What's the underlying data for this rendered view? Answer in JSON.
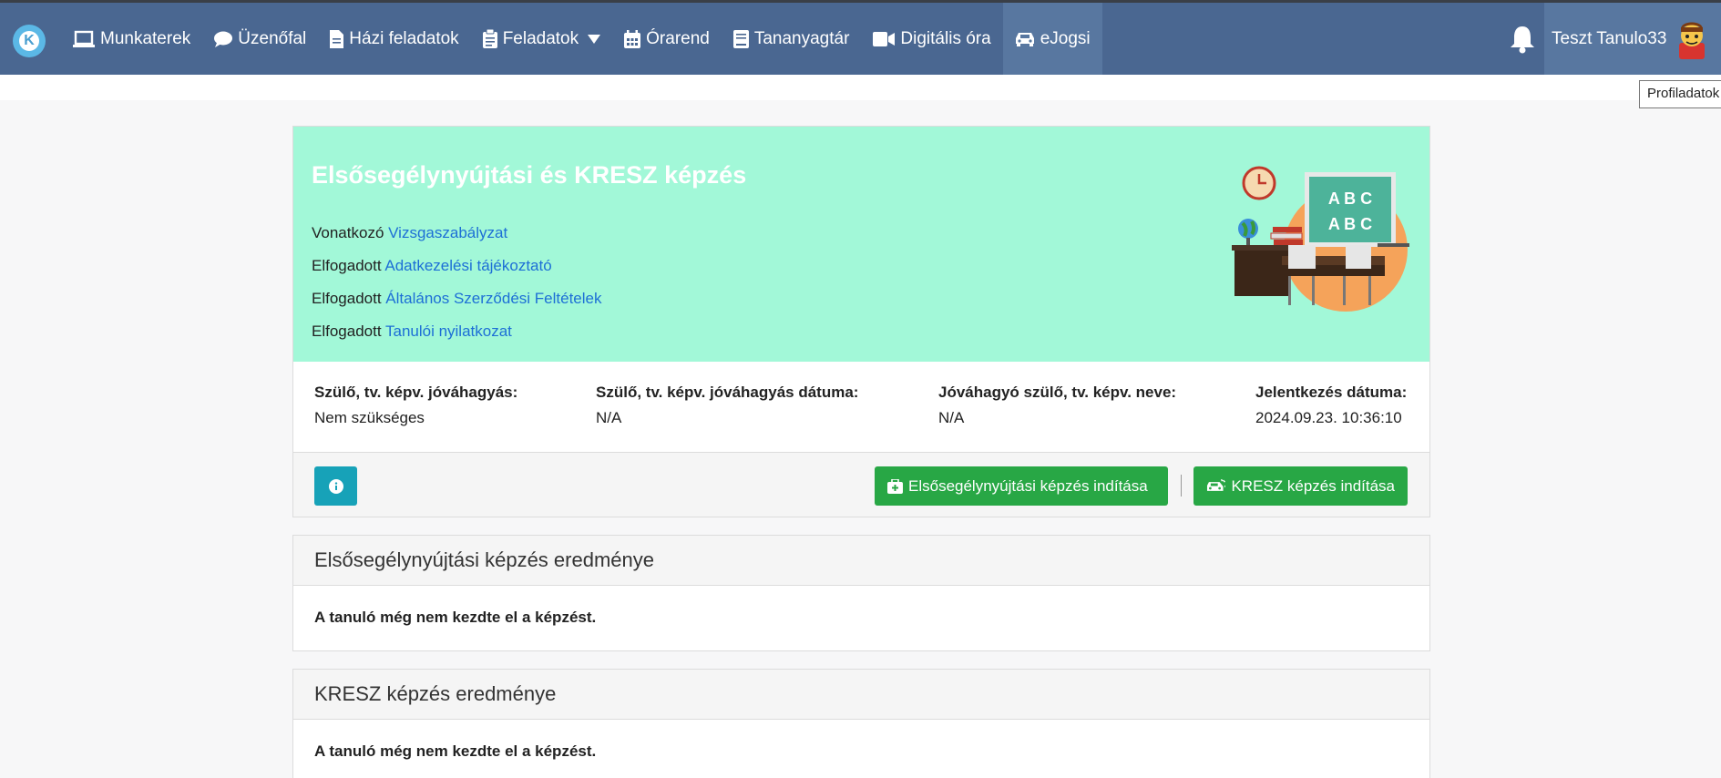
{
  "nav": {
    "logo_letter": "K",
    "items": [
      {
        "label": "Munkaterek",
        "icon": "laptop-icon"
      },
      {
        "label": "Üzenőfal",
        "icon": "comment-icon"
      },
      {
        "label": "Házi feladatok",
        "icon": "file-icon"
      },
      {
        "label": "Feladatok",
        "icon": "clipboard-icon"
      },
      {
        "label": "Órarend",
        "icon": "calendar-icon"
      },
      {
        "label": "Tananyagtár",
        "icon": "book-icon"
      },
      {
        "label": "Digitális óra",
        "icon": "video-icon"
      },
      {
        "label": "eJogsi",
        "icon": "car-icon"
      }
    ],
    "user_name": "Teszt Tanulo33",
    "tooltip": "Profiladatok"
  },
  "course": {
    "title": "Elsősegélynyújtási és KRESZ képzés",
    "lines": [
      {
        "prefix": "Vonatkozó",
        "link": "Vizsgaszabályzat"
      },
      {
        "prefix": "Elfogadott",
        "link": "Adatkezelési tájékoztató"
      },
      {
        "prefix": "Elfogadott",
        "link": "Általános Szerződési Feltételek"
      },
      {
        "prefix": "Elfogadott",
        "link": "Tanulói nyilatkozat"
      }
    ],
    "illustration_text": [
      "A B C",
      "A B C"
    ],
    "info": [
      {
        "label": "Szülő, tv. képv. jóváhagyás:",
        "value": "Nem szükséges"
      },
      {
        "label": "Szülő, tv. képv. jóváhagyás dátuma:",
        "value": "N/A"
      },
      {
        "label": "Jóváhagyó szülő, tv. képv. neve:",
        "value": "N/A"
      },
      {
        "label": "Jelentkezés dátuma:",
        "value": "2024.09.23. 10:36:10"
      }
    ],
    "btn_first_aid": "Elsősegélynyújtási képzés indítása",
    "btn_kresz": "KRESZ képzés indítása",
    "colors": {
      "hero": "#a2f8d8",
      "link": "#1d6fd6",
      "green": "#28a745",
      "info": "#17a2b8",
      "nav": "#4a6791"
    }
  },
  "results": [
    {
      "title": "Elsősegélynyújtási képzés eredménye",
      "text": "A tanuló még nem kezdte el a képzést."
    },
    {
      "title": "KRESZ képzés eredménye",
      "text": "A tanuló még nem kezdte el a képzést."
    }
  ]
}
